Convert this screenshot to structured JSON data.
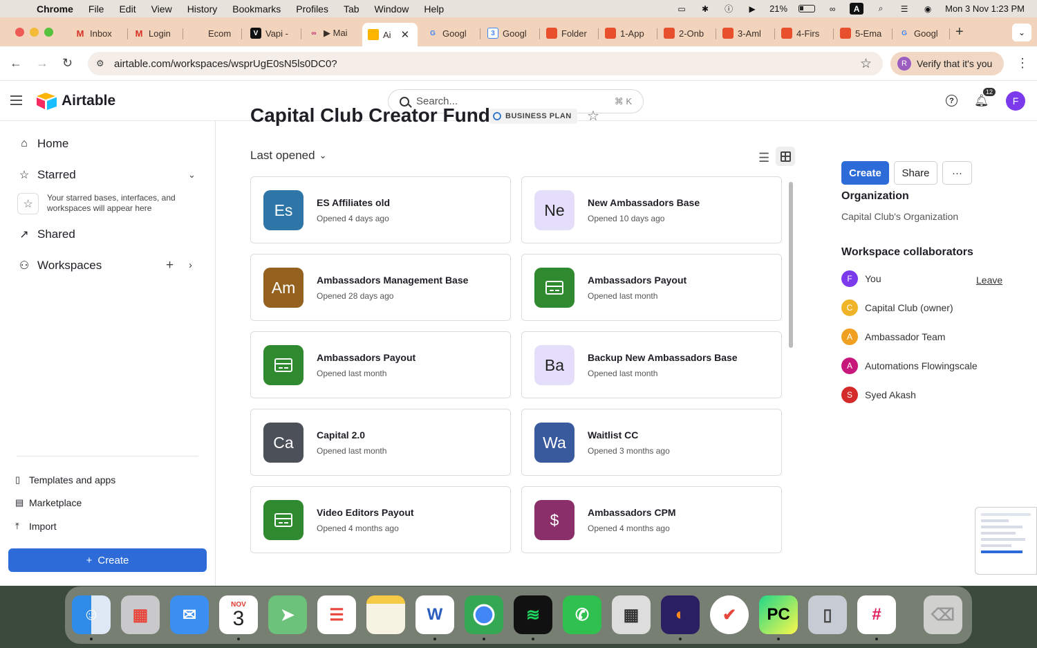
{
  "menubar": {
    "app": "Chrome",
    "items": [
      "File",
      "Edit",
      "View",
      "History",
      "Bookmarks",
      "Profiles",
      "Tab",
      "Window",
      "Help"
    ],
    "battery": "21%",
    "input_source": "A",
    "datetime": "Mon 3 Nov  1:23 PM"
  },
  "tabs": [
    {
      "label": "Inbox",
      "icon": "gmail-icon"
    },
    {
      "label": "Login",
      "icon": "gmail-icon"
    },
    {
      "label": "Ecom",
      "icon": "blank-icon"
    },
    {
      "label": "Vapi -",
      "icon": "vapi-icon"
    },
    {
      "label": "▶ Mai",
      "icon": "make-icon"
    },
    {
      "label": "Ai",
      "icon": "airtable-icon",
      "active": true
    },
    {
      "label": "Googl",
      "icon": "google-icon"
    },
    {
      "label": "Googl",
      "icon": "calendar-icon"
    },
    {
      "label": "Folder",
      "icon": "folder-icon"
    },
    {
      "label": "1-App",
      "icon": "doc-icon"
    },
    {
      "label": "2-Onb",
      "icon": "doc-icon"
    },
    {
      "label": "3-Aml",
      "icon": "doc-icon"
    },
    {
      "label": "4-Firs",
      "icon": "doc-icon"
    },
    {
      "label": "5-Ema",
      "icon": "doc-icon"
    },
    {
      "label": "Googl",
      "icon": "google-icon"
    }
  ],
  "toolbar": {
    "url": "airtable.com/workspaces/wsprUgE0sN5ls0DC0?",
    "verify_label": "Verify that it's you",
    "verify_avatar": "R"
  },
  "header": {
    "logo_text": "Airtable",
    "search_placeholder": "Search...",
    "search_shortcut": "⌘ K",
    "notification_count": "12",
    "user_initial": "F"
  },
  "sidebar": {
    "home": "Home",
    "starred": "Starred",
    "starred_empty": "Your starred bases, interfaces, and workspaces will appear here",
    "shared": "Shared",
    "workspaces": "Workspaces",
    "templates": "Templates and apps",
    "marketplace": "Marketplace",
    "import": "Import",
    "create": "Create"
  },
  "workspace": {
    "title": "Capital Club Creator Fund",
    "plan": "BUSINESS PLAN",
    "sort_label": "Last opened"
  },
  "bases": [
    {
      "abbr": "Es",
      "name": "ES Affiliates old",
      "opened": "Opened 4 days ago",
      "color": "#2f76a8",
      "light": false,
      "icon": ""
    },
    {
      "abbr": "Ne",
      "name": "New Ambassadors Base",
      "opened": "Opened 10 days ago",
      "color": "#e4defa",
      "light": true,
      "icon": ""
    },
    {
      "abbr": "Am",
      "name": "Ambassadors Management Base",
      "opened": "Opened 28 days ago",
      "color": "#94611f",
      "light": false,
      "icon": ""
    },
    {
      "abbr": "",
      "name": "Ambassadors Payout",
      "opened": "Opened last month",
      "color": "#2f8a2f",
      "light": false,
      "icon": "form-icon"
    },
    {
      "abbr": "",
      "name": "Ambassadors Payout",
      "opened": "Opened last month",
      "color": "#2f8a2f",
      "light": false,
      "icon": "form-icon"
    },
    {
      "abbr": "Ba",
      "name": "Backup New Ambassadors Base",
      "opened": "Opened last month",
      "color": "#e4defa",
      "light": true,
      "icon": ""
    },
    {
      "abbr": "Ca",
      "name": "Capital 2.0",
      "opened": "Opened last month",
      "color": "#4c5058",
      "light": false,
      "icon": ""
    },
    {
      "abbr": "Wa",
      "name": "Waitlist CC",
      "opened": "Opened 3 months ago",
      "color": "#3a5a9e",
      "light": false,
      "icon": ""
    },
    {
      "abbr": "",
      "name": "Video Editors Payout",
      "opened": "Opened 4 months ago",
      "color": "#2f8a2f",
      "light": false,
      "icon": "form-icon"
    },
    {
      "abbr": "$",
      "name": "Ambassadors CPM",
      "opened": "Opened 4 months ago",
      "color": "#8a2f6a",
      "light": false,
      "icon": ""
    }
  ],
  "right_panel": {
    "create": "Create",
    "share": "Share",
    "more": "···",
    "org_heading": "Organization",
    "org_name": "Capital Club's Organization",
    "collab_heading": "Workspace collaborators",
    "leave": "Leave",
    "collaborators": [
      {
        "initial": "F",
        "name": "You",
        "color": "#7c3aed"
      },
      {
        "initial": "C",
        "name": "Capital Club (owner)",
        "color": "#f0b429"
      },
      {
        "initial": "A",
        "name": "Ambassador Team",
        "color": "#f0a020"
      },
      {
        "initial": "A",
        "name": "Automations Flowingscale",
        "color": "#c8177a"
      },
      {
        "initial": "S",
        "name": "Syed Akash",
        "color": "#d42a2a"
      }
    ]
  },
  "dock": {
    "calendar_month": "NOV",
    "calendar_day": "3",
    "apps": [
      "finder-icon",
      "launchpad-icon",
      "mail-icon",
      "calendar-icon",
      "maps-icon",
      "reminders-icon",
      "notes-icon",
      "word-icon",
      "chrome-icon",
      "spotify-icon",
      "whatsapp-icon",
      "calculator-icon",
      "firefox-icon",
      "tick-icon",
      "pycharm-icon",
      "iphone-mirroring-icon",
      "slack-icon",
      "trash-icon"
    ]
  }
}
